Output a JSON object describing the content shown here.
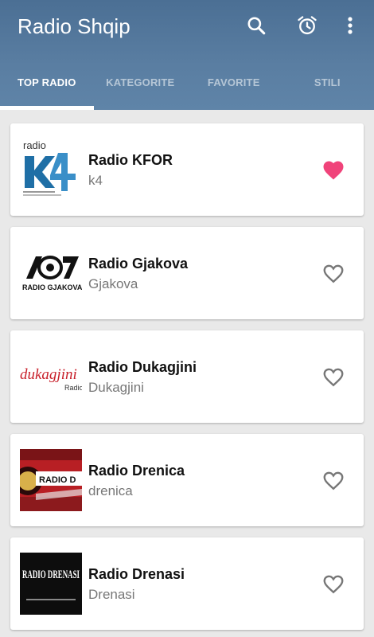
{
  "app": {
    "title": "Radio Shqip"
  },
  "tabs": [
    {
      "label": "TOP RADIO",
      "active": true
    },
    {
      "label": "KATEGORITE",
      "active": false
    },
    {
      "label": "FAVORITE",
      "active": false
    },
    {
      "label": "STILI",
      "active": false
    }
  ],
  "stations": [
    {
      "name": "Radio KFOR",
      "subtitle": "k4",
      "favorite": true,
      "logo_text": "radio"
    },
    {
      "name": "Radio Gjakova",
      "subtitle": "Gjakova",
      "favorite": false,
      "logo_text": "RADIO GJAKOVA"
    },
    {
      "name": "Radio Dukagjini",
      "subtitle": "Dukagjini",
      "favorite": false,
      "logo_text": "dukagjini"
    },
    {
      "name": "Radio Drenica",
      "subtitle": "drenica",
      "favorite": false,
      "logo_text": "RADIO D"
    },
    {
      "name": "Radio Drenasi",
      "subtitle": "Drenasi",
      "favorite": false,
      "logo_text": "RADIO DRENASI"
    }
  ],
  "colors": {
    "appbar": "#5a7ea2",
    "favorite_on": "#f0437a",
    "favorite_off": "#777777"
  }
}
